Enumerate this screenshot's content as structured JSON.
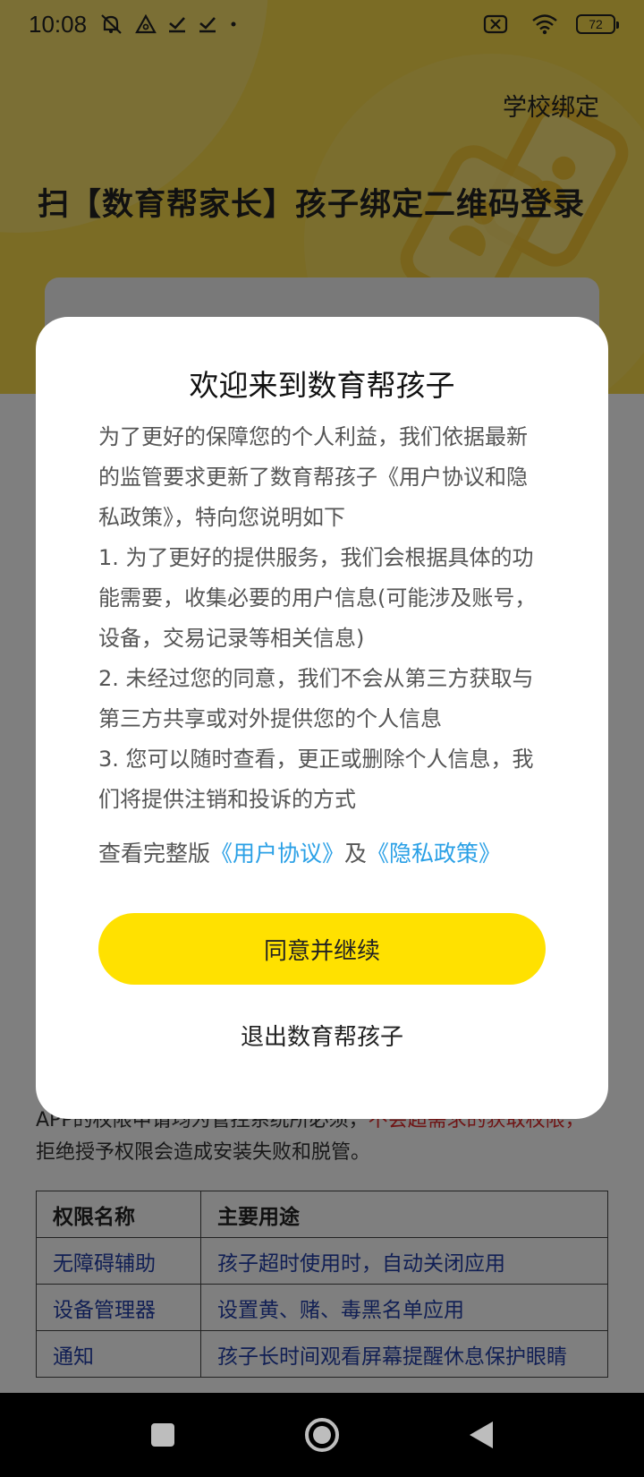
{
  "status_bar": {
    "time": "10:08",
    "battery": "72",
    "icons": [
      "alarm-off-icon",
      "vpn-triangle-icon",
      "check-icon",
      "check-icon",
      "dot-icon",
      "sim-error-icon",
      "wifi-icon",
      "battery-icon"
    ]
  },
  "header": {
    "school_link": "学校绑定",
    "title": "扫【数育帮家长】孩子绑定二维码登录"
  },
  "permissions": {
    "note_prefix": "APP的权限申请均为管控系统所必须，",
    "note_warn": "不会超需求的获取权限，",
    "note_suffix": "拒绝授予权限会造成安装失败和脱管。",
    "columns": [
      "权限名称",
      "主要用途"
    ],
    "rows": [
      [
        "无障碍辅助",
        "孩子超时使用时，自动关闭应用"
      ],
      [
        "设备管理器",
        "设置黄、赌、毒黑名单应用"
      ],
      [
        "通知",
        "孩子长时间观看屏幕提醒休息保护眼睛"
      ]
    ]
  },
  "dialog": {
    "title": "欢迎来到数育帮孩子",
    "paragraphs": [
      "为了更好的保障您的个人利益，我们依据最新的监管要求更新了数育帮孩子《用户协议和隐私政策》，特向您说明如下",
      "1. 为了更好的提供服务，我们会根据具体的功能需要，收集必要的用户信息(可能涉及账号，设备，交易记录等相关信息)",
      "2. 未经过您的同意，我们不会从第三方获取与第三方共享或对外提供您的个人信息",
      "3. 您可以随时查看，更正或删除个人信息，我们将提供注销和投诉的方式"
    ],
    "links_prefix": "查看完整版",
    "user_agreement": "《用户协议》",
    "and": "及",
    "privacy_policy": "《隐私政策》",
    "agree_button": "同意并继续",
    "exit_button": "退出数育帮孩子"
  },
  "nav_bar": {
    "buttons": [
      "recent-apps-icon",
      "home-icon",
      "back-icon"
    ]
  }
}
